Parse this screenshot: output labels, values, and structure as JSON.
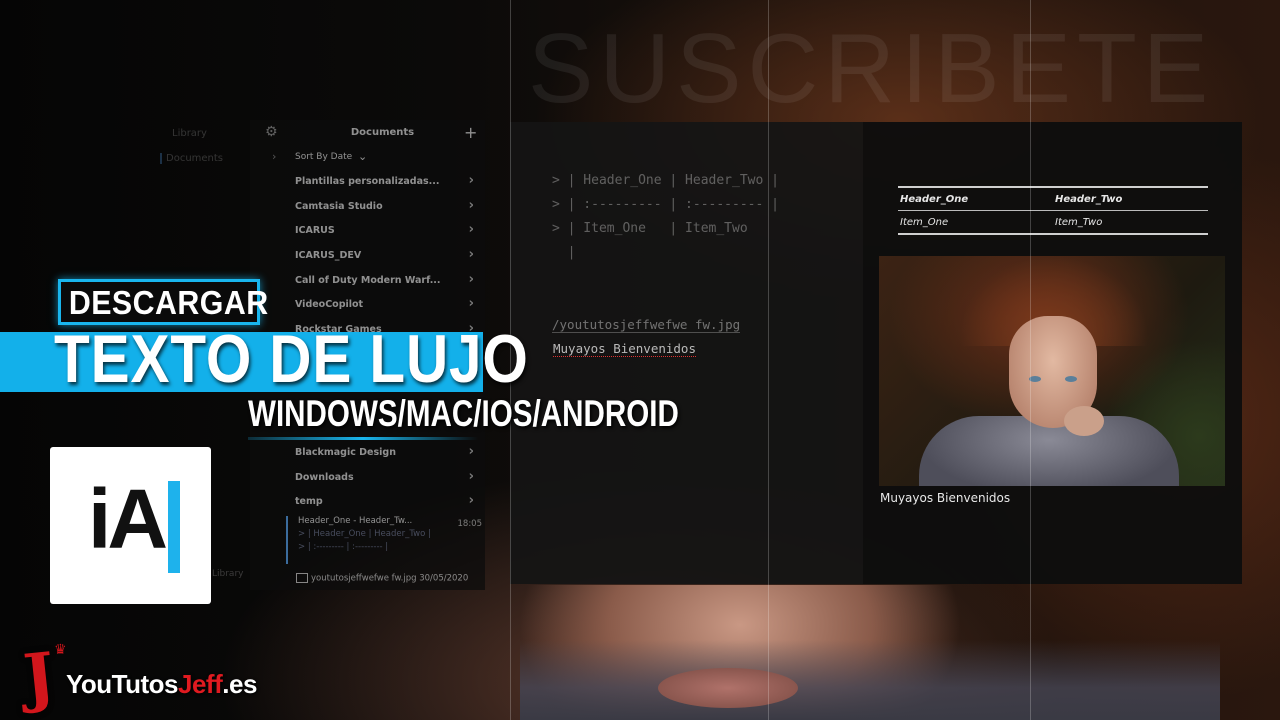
{
  "background": {
    "watermark": "SUSCRIBETE"
  },
  "sidebar": {
    "ghost_items": [
      "Library",
      "Documents",
      "Library"
    ]
  },
  "documents_panel": {
    "title": "Documents",
    "sort_label": "Sort By Date",
    "folders": [
      "Plantillas personalizadas...",
      "Camtasia Studio",
      "ICARUS",
      "ICARUS_DEV",
      "Call of Duty Modern Warf...",
      "VideoCopilot",
      "Rockstar Games",
      "Blackmagic Design",
      "Downloads",
      "temp"
    ],
    "note": {
      "title": "Header_One - Header_Tw...",
      "time": "18:05",
      "preview_line1": "> | Header_One | Header_Two |",
      "preview_line2": "> | :--------- | :--------- |"
    },
    "image_file": {
      "name": "yoututosjeffwefwe fw.jpg",
      "date": "30/05/2020"
    }
  },
  "editor": {
    "lines": [
      "> | Header_One | Header_Two |",
      "> | :--------- | :--------- |",
      "> | Item_One   | Item_Two",
      "  |"
    ],
    "image_path": "/yoututosjeffwefwe fw.jpg",
    "caption": "Muyayos Bienvenidos"
  },
  "preview": {
    "table": {
      "headers": [
        "Header_One",
        "Header_Two"
      ],
      "rows": [
        [
          "Item_One",
          "Item_Two"
        ]
      ]
    },
    "caption": "Muyayos Bienvenidos"
  },
  "overlay": {
    "badge": "DESCARGAR",
    "headline": "TEXTO DE LUJO",
    "platforms": "WINDOWS/MAC/IOS/ANDROID",
    "app_logo_text": "iA",
    "accent_color": "#13b0ea"
  },
  "brand": {
    "name_part1": "YouTutos",
    "name_part2": "Jeff",
    "name_part3": ".es",
    "color": "#d2161c"
  }
}
